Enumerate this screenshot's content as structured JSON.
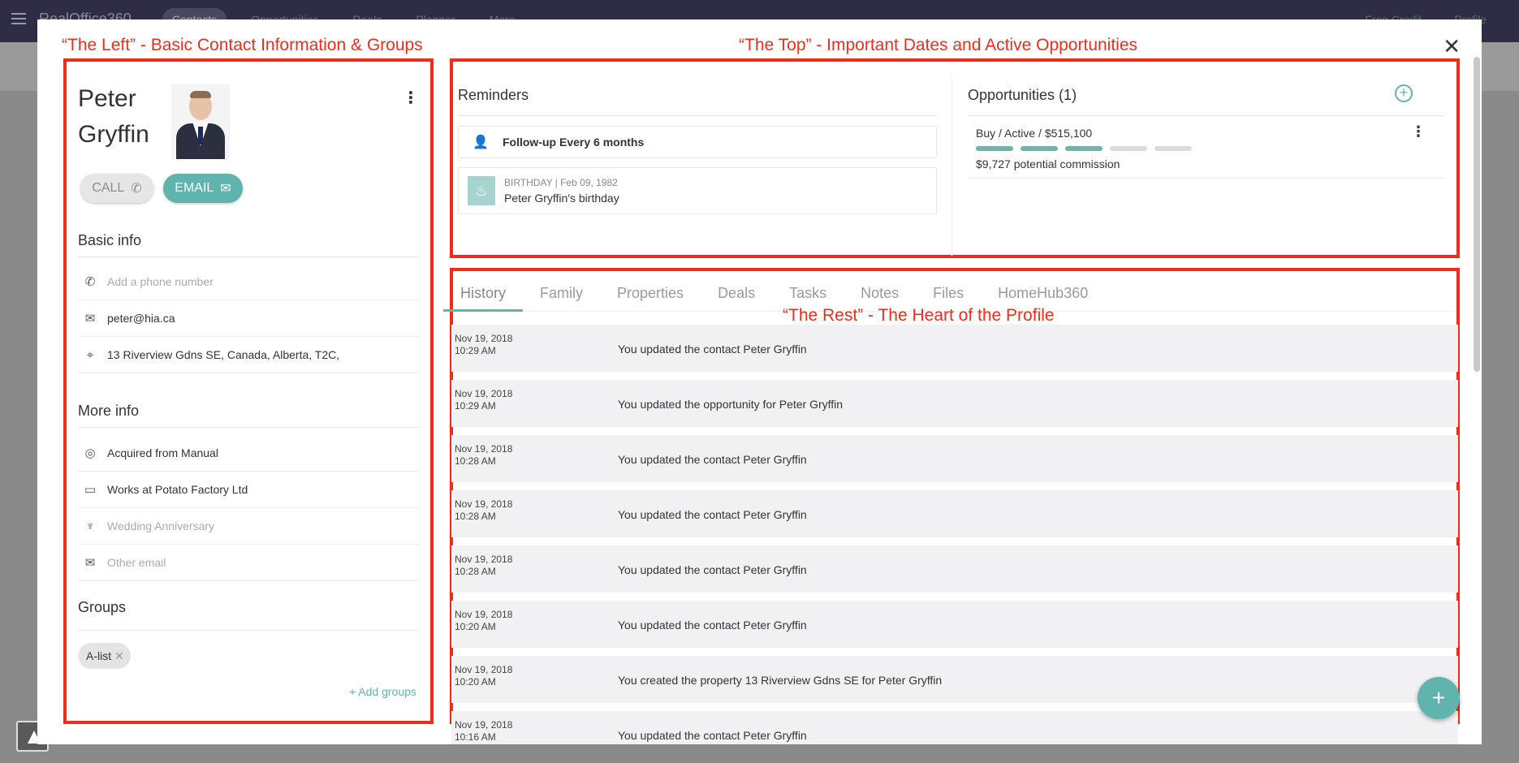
{
  "app": {
    "brand": "RealOffice360",
    "nav": [
      "Contacts",
      "Opportunities",
      "Deals",
      "Planner",
      "More"
    ],
    "right": [
      "Free Credit",
      "Profile"
    ]
  },
  "annotations": {
    "left": "“The Left” - Basic Contact Information & Groups",
    "top": "“The Top” - Important Dates and Active Opportunities",
    "rest": "“The Rest” - The Heart of the Profile"
  },
  "contact": {
    "first_name": "Peter",
    "last_name": "Gryffin",
    "call_label": "CALL",
    "email_label": "EMAIL"
  },
  "basic_info": {
    "title": "Basic info",
    "phone_placeholder": "Add a phone number",
    "email": "peter@hia.ca",
    "address": "13 Riverview Gdns SE, Canada, Alberta, T2C,"
  },
  "more_info": {
    "title": "More info",
    "acquired": "Acquired from Manual",
    "works_at": "Works at Potato Factory Ltd",
    "anniversary_placeholder": "Wedding Anniversary",
    "other_email_placeholder": "Other email"
  },
  "groups": {
    "title": "Groups",
    "items": [
      "A-list"
    ],
    "add_label": "+ Add groups"
  },
  "reminders": {
    "title": "Reminders",
    "followup": "Follow-up Every 6 months",
    "birthday_meta": "BIRTHDAY | Feb 09, 1982",
    "birthday_label": "Peter Gryffin's birthday"
  },
  "opportunities": {
    "title": "Opportunities (1)",
    "item": {
      "label": "Buy / Active / $515,100",
      "progress_steps_done": 3,
      "progress_steps_total": 5,
      "commission": "$9,727 potential commission"
    }
  },
  "tabs": [
    "History",
    "Family",
    "Properties",
    "Deals",
    "Tasks",
    "Notes",
    "Files",
    "HomeHub360"
  ],
  "history": [
    {
      "date": "Nov 19, 2018",
      "time": "10:29 AM",
      "text": "You updated the contact Peter Gryffin"
    },
    {
      "date": "Nov 19, 2018",
      "time": "10:29 AM",
      "text": "You updated the opportunity for Peter Gryffin"
    },
    {
      "date": "Nov 19, 2018",
      "time": "10:28 AM",
      "text": "You updated the contact Peter Gryffin"
    },
    {
      "date": "Nov 19, 2018",
      "time": "10:28 AM",
      "text": "You updated the contact Peter Gryffin"
    },
    {
      "date": "Nov 19, 2018",
      "time": "10:28 AM",
      "text": "You updated the contact Peter Gryffin"
    },
    {
      "date": "Nov 19, 2018",
      "time": "10:20 AM",
      "text": "You updated the contact Peter Gryffin"
    },
    {
      "date": "Nov 19, 2018",
      "time": "10:20 AM",
      "text": "You created the property 13 Riverview Gdns SE for Peter Gryffin"
    },
    {
      "date": "Nov 19, 2018",
      "time": "10:16 AM",
      "text": "You updated the contact Peter Gryffin"
    }
  ],
  "colors": {
    "accent": "#5fb5ad",
    "annotation": "#ef2b1a",
    "topbar": "#2f2d45"
  }
}
